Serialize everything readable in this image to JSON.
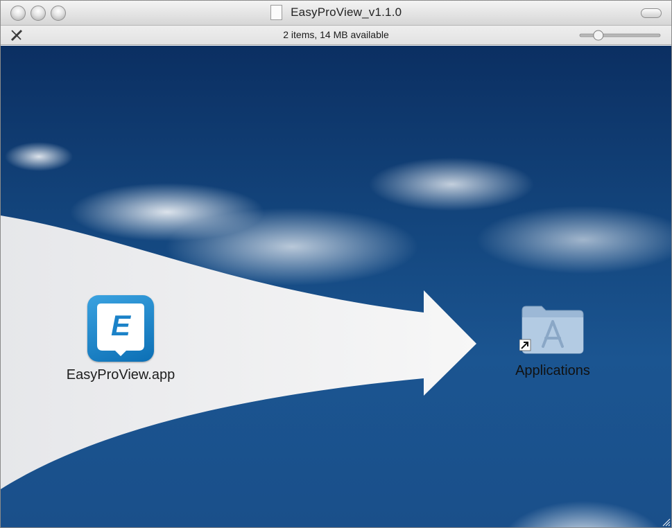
{
  "window": {
    "title": "EasyProView_v1.1.0",
    "status": "2 items, 14 MB available"
  },
  "icons": {
    "close": "close-button-icon",
    "minimize": "minimize-button-icon",
    "zoom": "zoom-button-icon",
    "document": "document-icon",
    "pencil": "pencil-icon",
    "slider": "icon-size-slider",
    "app": "easyproview-app-icon",
    "folder": "applications-folder-icon",
    "alias": "alias-arrow-icon"
  },
  "items": [
    {
      "label": "EasyProView.app"
    },
    {
      "label": "Applications"
    }
  ],
  "app_icon_letter": "E",
  "slider_value": 0.2,
  "colors": {
    "sky": "#14477f",
    "arrow": "#ececec",
    "app_icon_blue": "#1b82c8"
  }
}
